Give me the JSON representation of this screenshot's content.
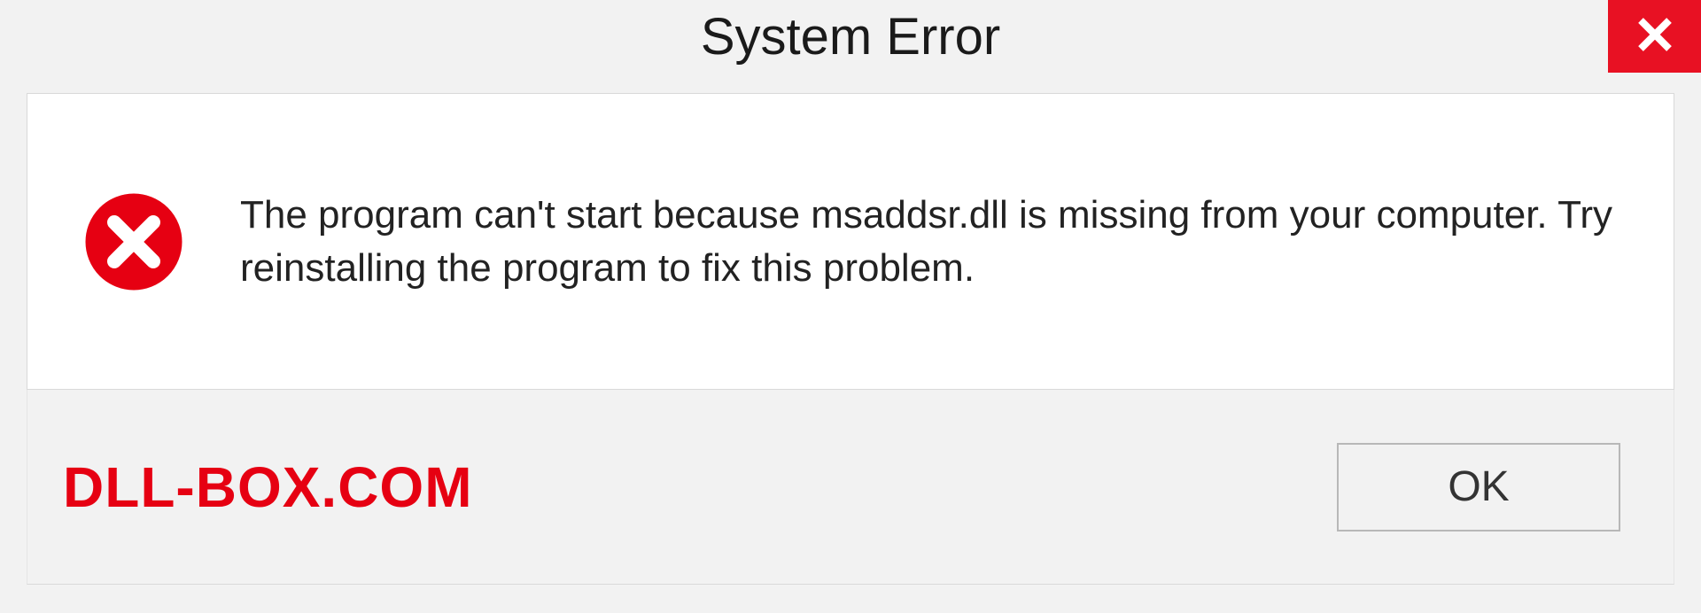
{
  "title": "System Error",
  "message": "The program can't start because msaddsr.dll is missing from your computer. Try reinstalling the program to fix this problem.",
  "brand": "DLL-BOX.COM",
  "ok_label": "OK",
  "colors": {
    "close_red": "#e81123",
    "error_red": "#e60012",
    "brand_red": "#e60012"
  }
}
